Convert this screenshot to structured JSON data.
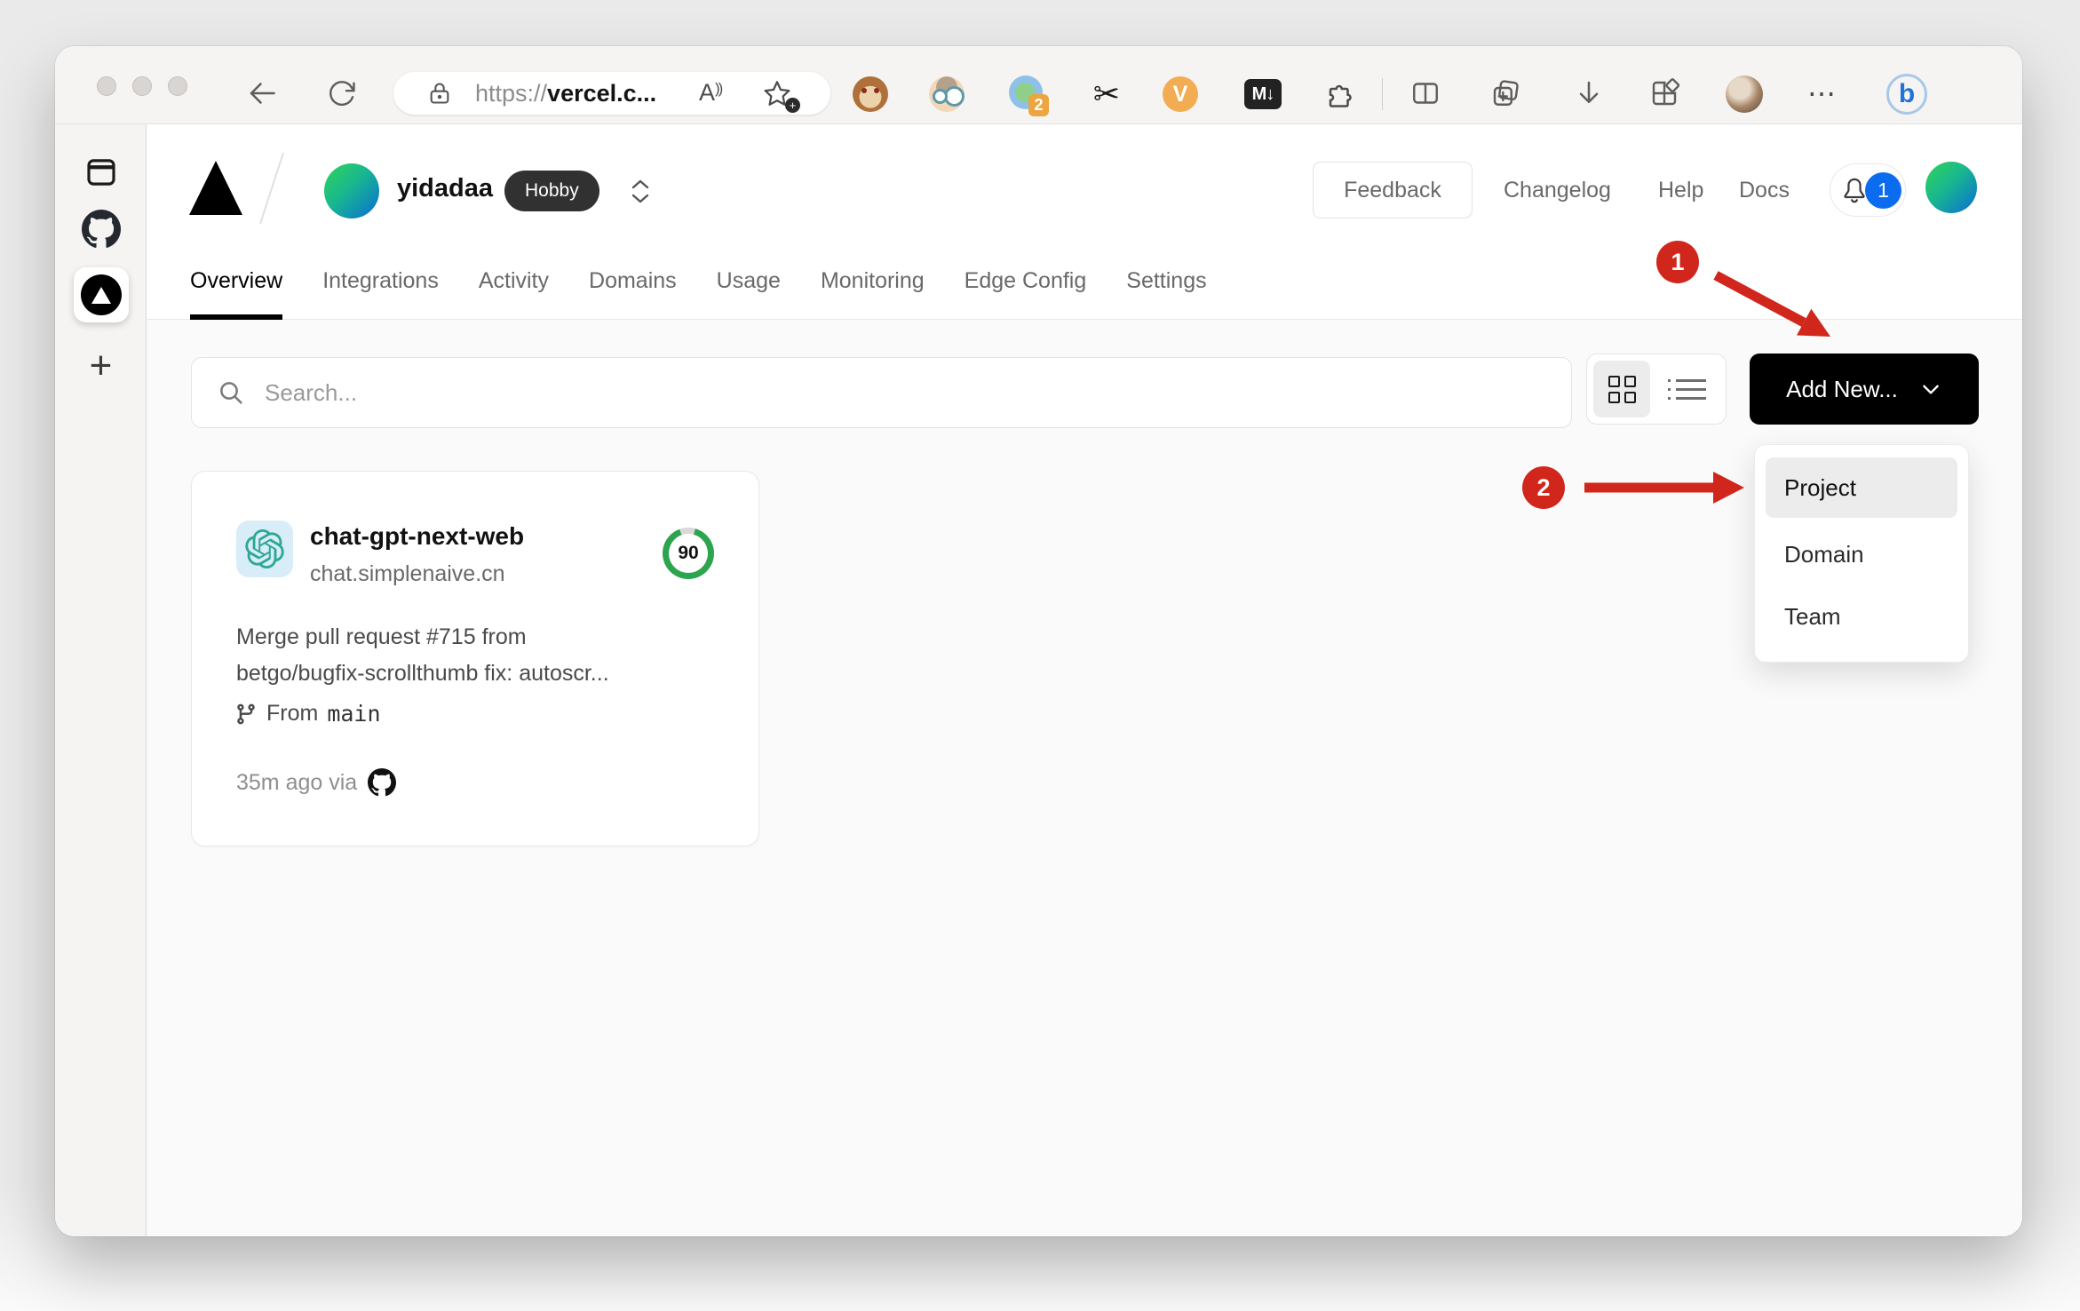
{
  "colors": {
    "annotation_red": "#d0261c",
    "notification_blue": "#0b6cf0",
    "score_green": "#2da44e",
    "add_new_black": "#000000",
    "hobby_badge_bg": "#313131",
    "openai_teal": "#2fa795",
    "content_bg": "#fafafa"
  },
  "browser": {
    "url_scheme": "https://",
    "url_host": "vercel.c...",
    "read_aloud_letter": "A",
    "extensions": {
      "proxy_badge": "2",
      "scissors_glyph": "✂",
      "v_letter": "V",
      "markdown_label": "M↓"
    },
    "more_glyph": "⋯",
    "bing_letter": "b"
  },
  "edge_sidebar": {
    "plus_glyph": "+"
  },
  "vercel": {
    "team": "yidadaa",
    "plan_badge": "Hobby",
    "nav": {
      "feedback": "Feedback",
      "changelog": "Changelog",
      "help": "Help",
      "docs": "Docs",
      "notification_count": "1"
    },
    "tabs": [
      "Overview",
      "Integrations",
      "Activity",
      "Domains",
      "Usage",
      "Monitoring",
      "Edge Config",
      "Settings"
    ],
    "toolbar": {
      "search_placeholder": "Search...",
      "add_new": "Add New..."
    },
    "dropdown": {
      "items": [
        "Project",
        "Domain",
        "Team"
      ]
    },
    "card": {
      "name": "chat-gpt-next-web",
      "domain": "chat.simplenaive.cn",
      "score": "90",
      "commit_line1": "Merge pull request #715 from",
      "commit_line2": "betgo/bugfix-scrollthumb fix: autoscr...",
      "from_label": "From",
      "branch": "main",
      "deployed": "35m ago via"
    },
    "annotations": {
      "step1": "1",
      "step2": "2"
    }
  }
}
